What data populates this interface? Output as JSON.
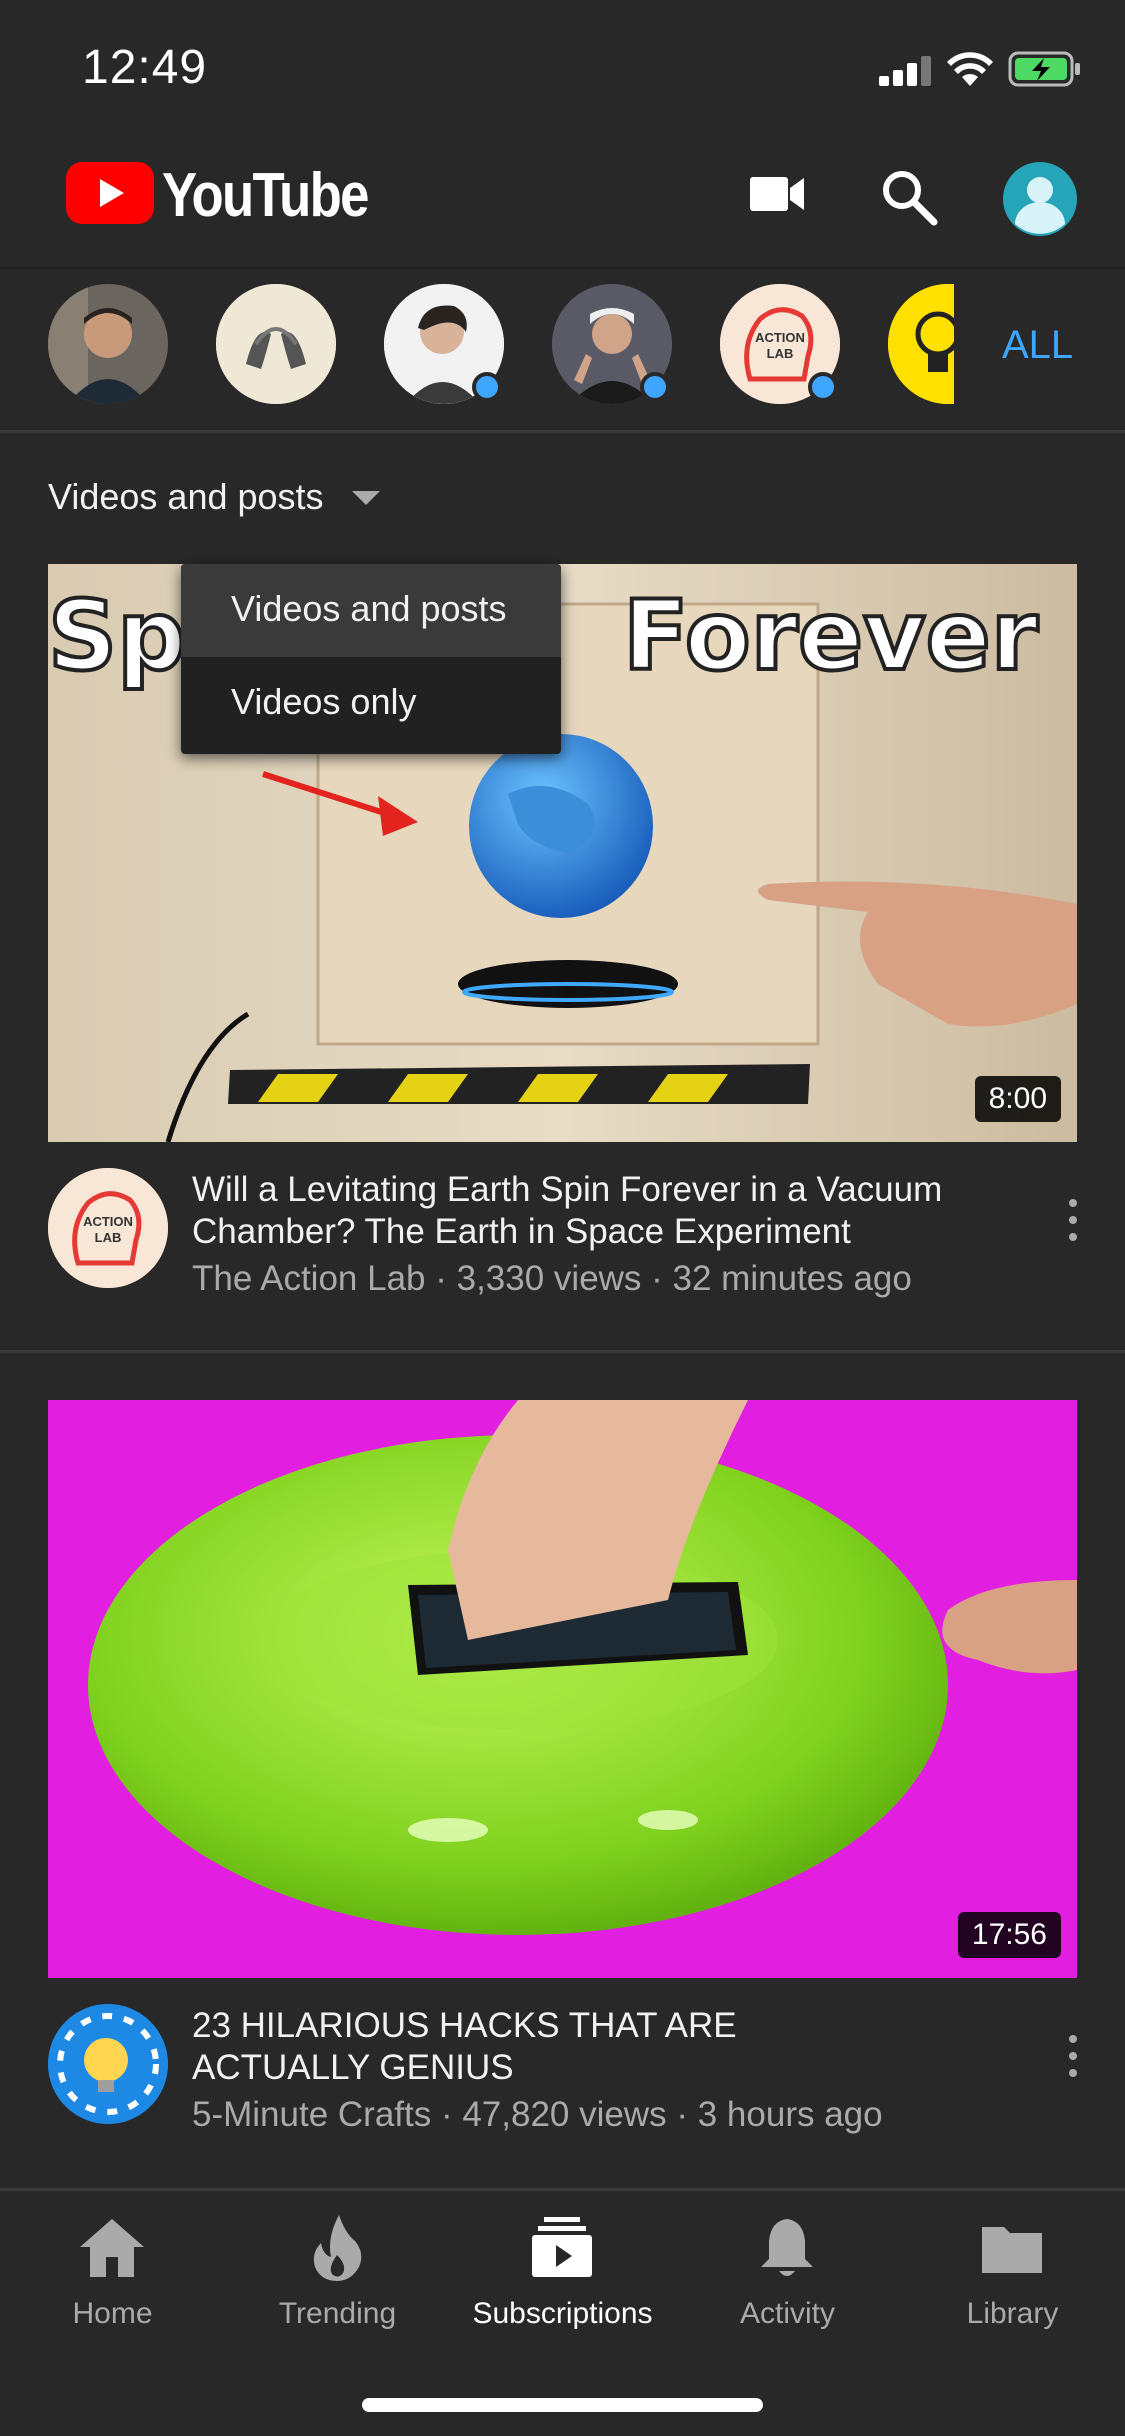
{
  "status_bar": {
    "time": "12:49"
  },
  "header": {
    "brand": "YouTube"
  },
  "channels": {
    "all_label": "ALL",
    "items": [
      {
        "name": "channel-1",
        "has_new": false
      },
      {
        "name": "channel-2",
        "has_new": false
      },
      {
        "name": "channel-3",
        "has_new": true
      },
      {
        "name": "channel-4",
        "has_new": true
      },
      {
        "name": "The Action Lab",
        "has_new": true
      },
      {
        "name": "5-Minute Crafts",
        "has_new": false
      }
    ]
  },
  "filter": {
    "selected": "Videos and posts",
    "options": [
      "Videos and posts",
      "Videos only"
    ]
  },
  "videos": [
    {
      "thumb_text": "Forever",
      "thumb_text_left": "Sp",
      "duration": "8:00",
      "title": "Will a Levitating Earth Spin Forever in a Vacuum Chamber? The Earth in Space Experiment",
      "meta": "The Action Lab · 3,330 views · 32 minutes ago",
      "avatar_line1": "ACTION",
      "avatar_line2": "LAB"
    },
    {
      "duration": "17:56",
      "title": "23 HILARIOUS HACKS THAT ARE ACTUALLY GENIUS",
      "meta": "5-Minute Crafts · 47,820 views · 3 hours ago"
    }
  ],
  "bottom_nav": [
    {
      "label": "Home",
      "icon": "home-icon"
    },
    {
      "label": "Trending",
      "icon": "flame-icon"
    },
    {
      "label": "Subscriptions",
      "icon": "subscriptions-icon",
      "active": true
    },
    {
      "label": "Activity",
      "icon": "bell-icon"
    },
    {
      "label": "Library",
      "icon": "folder-icon"
    }
  ],
  "colors": {
    "background": "#282828",
    "accent_blue": "#3ea6ff",
    "brand_red": "#ff0000"
  }
}
